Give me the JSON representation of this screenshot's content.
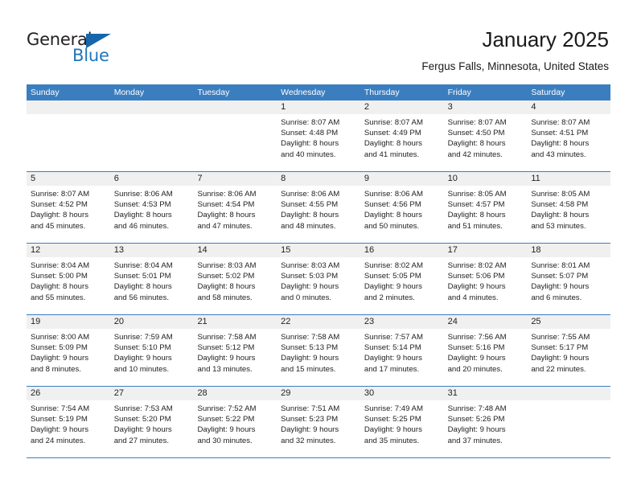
{
  "brand": {
    "name_part1": "General",
    "name_part2": "Blue",
    "logo_icon": "triangle-flag-icon",
    "accent_color": "#1e76bd"
  },
  "header": {
    "title": "January 2025",
    "subtitle": "Fergus Falls, Minnesota, United States"
  },
  "calendar": {
    "header_bg": "#3b7ebf",
    "day_band_bg": "#f0f0f0",
    "weekdays": [
      "Sunday",
      "Monday",
      "Tuesday",
      "Wednesday",
      "Thursday",
      "Friday",
      "Saturday"
    ],
    "weeks": [
      [
        {
          "day": "",
          "empty": true
        },
        {
          "day": "",
          "empty": true
        },
        {
          "day": "",
          "empty": true
        },
        {
          "day": "1",
          "sunrise": "Sunrise: 8:07 AM",
          "sunset": "Sunset: 4:48 PM",
          "daylight1": "Daylight: 8 hours",
          "daylight2": "and 40 minutes."
        },
        {
          "day": "2",
          "sunrise": "Sunrise: 8:07 AM",
          "sunset": "Sunset: 4:49 PM",
          "daylight1": "Daylight: 8 hours",
          "daylight2": "and 41 minutes."
        },
        {
          "day": "3",
          "sunrise": "Sunrise: 8:07 AM",
          "sunset": "Sunset: 4:50 PM",
          "daylight1": "Daylight: 8 hours",
          "daylight2": "and 42 minutes."
        },
        {
          "day": "4",
          "sunrise": "Sunrise: 8:07 AM",
          "sunset": "Sunset: 4:51 PM",
          "daylight1": "Daylight: 8 hours",
          "daylight2": "and 43 minutes."
        }
      ],
      [
        {
          "day": "5",
          "sunrise": "Sunrise: 8:07 AM",
          "sunset": "Sunset: 4:52 PM",
          "daylight1": "Daylight: 8 hours",
          "daylight2": "and 45 minutes."
        },
        {
          "day": "6",
          "sunrise": "Sunrise: 8:06 AM",
          "sunset": "Sunset: 4:53 PM",
          "daylight1": "Daylight: 8 hours",
          "daylight2": "and 46 minutes."
        },
        {
          "day": "7",
          "sunrise": "Sunrise: 8:06 AM",
          "sunset": "Sunset: 4:54 PM",
          "daylight1": "Daylight: 8 hours",
          "daylight2": "and 47 minutes."
        },
        {
          "day": "8",
          "sunrise": "Sunrise: 8:06 AM",
          "sunset": "Sunset: 4:55 PM",
          "daylight1": "Daylight: 8 hours",
          "daylight2": "and 48 minutes."
        },
        {
          "day": "9",
          "sunrise": "Sunrise: 8:06 AM",
          "sunset": "Sunset: 4:56 PM",
          "daylight1": "Daylight: 8 hours",
          "daylight2": "and 50 minutes."
        },
        {
          "day": "10",
          "sunrise": "Sunrise: 8:05 AM",
          "sunset": "Sunset: 4:57 PM",
          "daylight1": "Daylight: 8 hours",
          "daylight2": "and 51 minutes."
        },
        {
          "day": "11",
          "sunrise": "Sunrise: 8:05 AM",
          "sunset": "Sunset: 4:58 PM",
          "daylight1": "Daylight: 8 hours",
          "daylight2": "and 53 minutes."
        }
      ],
      [
        {
          "day": "12",
          "sunrise": "Sunrise: 8:04 AM",
          "sunset": "Sunset: 5:00 PM",
          "daylight1": "Daylight: 8 hours",
          "daylight2": "and 55 minutes."
        },
        {
          "day": "13",
          "sunrise": "Sunrise: 8:04 AM",
          "sunset": "Sunset: 5:01 PM",
          "daylight1": "Daylight: 8 hours",
          "daylight2": "and 56 minutes."
        },
        {
          "day": "14",
          "sunrise": "Sunrise: 8:03 AM",
          "sunset": "Sunset: 5:02 PM",
          "daylight1": "Daylight: 8 hours",
          "daylight2": "and 58 minutes."
        },
        {
          "day": "15",
          "sunrise": "Sunrise: 8:03 AM",
          "sunset": "Sunset: 5:03 PM",
          "daylight1": "Daylight: 9 hours",
          "daylight2": "and 0 minutes."
        },
        {
          "day": "16",
          "sunrise": "Sunrise: 8:02 AM",
          "sunset": "Sunset: 5:05 PM",
          "daylight1": "Daylight: 9 hours",
          "daylight2": "and 2 minutes."
        },
        {
          "day": "17",
          "sunrise": "Sunrise: 8:02 AM",
          "sunset": "Sunset: 5:06 PM",
          "daylight1": "Daylight: 9 hours",
          "daylight2": "and 4 minutes."
        },
        {
          "day": "18",
          "sunrise": "Sunrise: 8:01 AM",
          "sunset": "Sunset: 5:07 PM",
          "daylight1": "Daylight: 9 hours",
          "daylight2": "and 6 minutes."
        }
      ],
      [
        {
          "day": "19",
          "sunrise": "Sunrise: 8:00 AM",
          "sunset": "Sunset: 5:09 PM",
          "daylight1": "Daylight: 9 hours",
          "daylight2": "and 8 minutes."
        },
        {
          "day": "20",
          "sunrise": "Sunrise: 7:59 AM",
          "sunset": "Sunset: 5:10 PM",
          "daylight1": "Daylight: 9 hours",
          "daylight2": "and 10 minutes."
        },
        {
          "day": "21",
          "sunrise": "Sunrise: 7:58 AM",
          "sunset": "Sunset: 5:12 PM",
          "daylight1": "Daylight: 9 hours",
          "daylight2": "and 13 minutes."
        },
        {
          "day": "22",
          "sunrise": "Sunrise: 7:58 AM",
          "sunset": "Sunset: 5:13 PM",
          "daylight1": "Daylight: 9 hours",
          "daylight2": "and 15 minutes."
        },
        {
          "day": "23",
          "sunrise": "Sunrise: 7:57 AM",
          "sunset": "Sunset: 5:14 PM",
          "daylight1": "Daylight: 9 hours",
          "daylight2": "and 17 minutes."
        },
        {
          "day": "24",
          "sunrise": "Sunrise: 7:56 AM",
          "sunset": "Sunset: 5:16 PM",
          "daylight1": "Daylight: 9 hours",
          "daylight2": "and 20 minutes."
        },
        {
          "day": "25",
          "sunrise": "Sunrise: 7:55 AM",
          "sunset": "Sunset: 5:17 PM",
          "daylight1": "Daylight: 9 hours",
          "daylight2": "and 22 minutes."
        }
      ],
      [
        {
          "day": "26",
          "sunrise": "Sunrise: 7:54 AM",
          "sunset": "Sunset: 5:19 PM",
          "daylight1": "Daylight: 9 hours",
          "daylight2": "and 24 minutes."
        },
        {
          "day": "27",
          "sunrise": "Sunrise: 7:53 AM",
          "sunset": "Sunset: 5:20 PM",
          "daylight1": "Daylight: 9 hours",
          "daylight2": "and 27 minutes."
        },
        {
          "day": "28",
          "sunrise": "Sunrise: 7:52 AM",
          "sunset": "Sunset: 5:22 PM",
          "daylight1": "Daylight: 9 hours",
          "daylight2": "and 30 minutes."
        },
        {
          "day": "29",
          "sunrise": "Sunrise: 7:51 AM",
          "sunset": "Sunset: 5:23 PM",
          "daylight1": "Daylight: 9 hours",
          "daylight2": "and 32 minutes."
        },
        {
          "day": "30",
          "sunrise": "Sunrise: 7:49 AM",
          "sunset": "Sunset: 5:25 PM",
          "daylight1": "Daylight: 9 hours",
          "daylight2": "and 35 minutes."
        },
        {
          "day": "31",
          "sunrise": "Sunrise: 7:48 AM",
          "sunset": "Sunset: 5:26 PM",
          "daylight1": "Daylight: 9 hours",
          "daylight2": "and 37 minutes."
        },
        {
          "day": "",
          "empty": true
        }
      ]
    ]
  }
}
